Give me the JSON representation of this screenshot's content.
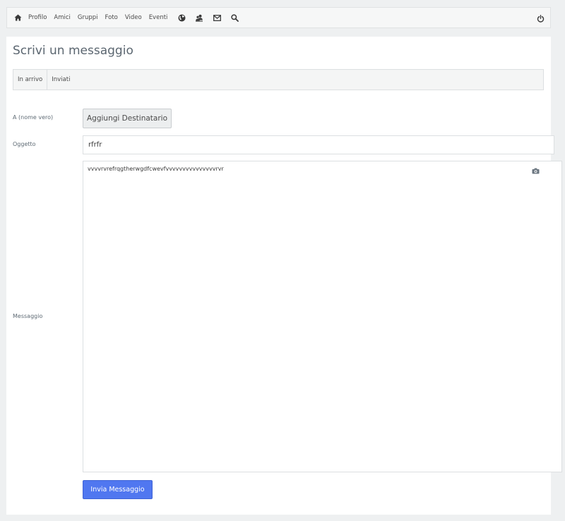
{
  "nav": {
    "links": [
      "Profilo",
      "Amici",
      "Gruppi",
      "Foto",
      "Video",
      "Eventi"
    ],
    "icons": [
      "home-icon",
      "globe-icon",
      "contacts-icon",
      "envelope-icon",
      "search-icon",
      "power-icon"
    ]
  },
  "page": {
    "title": "Scrivi un messaggio"
  },
  "tabs": [
    "In arrivo",
    "Inviati"
  ],
  "form": {
    "to_label": "A (nome vero)",
    "add_recipient_label": "Aggiungi Destinatario",
    "subject_label": "Oggetto",
    "subject_value": "rfrfr",
    "message_label": "Messaggio",
    "message_value": "vvvvrvrefrqgtherwgdfcwevfvvvvvvvvvvvvvvvrvr",
    "send_label": "Invia Messaggio"
  },
  "colors": {
    "primary_button": "#5077f0",
    "page_background": "#eef0f1"
  }
}
